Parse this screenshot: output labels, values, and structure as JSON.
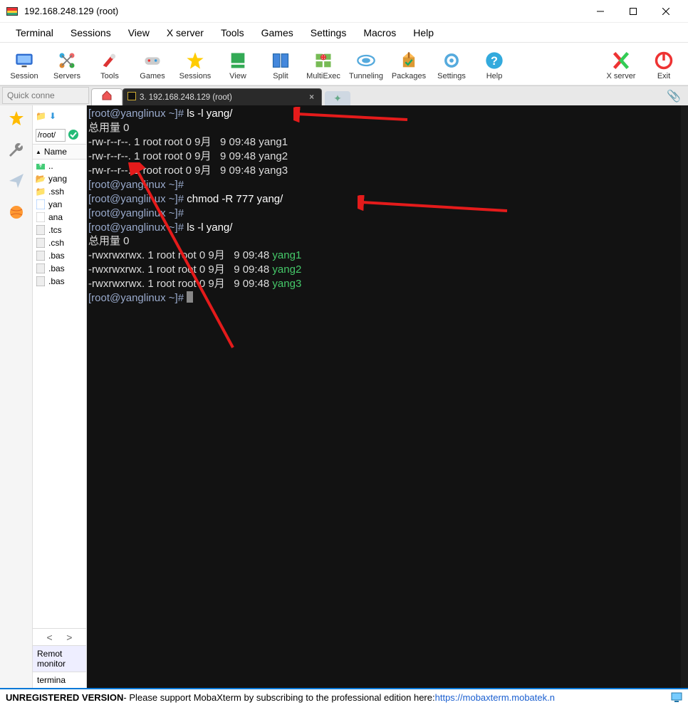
{
  "title": "192.168.248.129 (root)",
  "menus": [
    "Terminal",
    "Sessions",
    "View",
    "X server",
    "Tools",
    "Games",
    "Settings",
    "Macros",
    "Help"
  ],
  "toolbar": [
    {
      "id": "session",
      "label": "Session"
    },
    {
      "id": "servers",
      "label": "Servers"
    },
    {
      "id": "tools",
      "label": "Tools"
    },
    {
      "id": "games",
      "label": "Games"
    },
    {
      "id": "sessions",
      "label": "Sessions"
    },
    {
      "id": "view",
      "label": "View"
    },
    {
      "id": "split",
      "label": "Split"
    },
    {
      "id": "multiexec",
      "label": "MultiExec"
    },
    {
      "id": "tunneling",
      "label": "Tunneling"
    },
    {
      "id": "packages",
      "label": "Packages"
    },
    {
      "id": "settings",
      "label": "Settings"
    },
    {
      "id": "help",
      "label": "Help"
    },
    {
      "id": "xserver",
      "label": "X server"
    },
    {
      "id": "exit",
      "label": "Exit"
    }
  ],
  "quick_connect_placeholder": "Quick conne",
  "tab": {
    "label": "3. 192.168.248.129 (root)"
  },
  "sftp": {
    "path": "/root/",
    "head": "Name",
    "items": [
      {
        "name": "..",
        "type": "up"
      },
      {
        "name": "yang",
        "type": "folder-o"
      },
      {
        "name": ".ssh",
        "type": "folder"
      },
      {
        "name": "yan",
        "type": "file"
      },
      {
        "name": "ana",
        "type": "file-d"
      },
      {
        "name": ".tcs",
        "type": "file-g"
      },
      {
        "name": ".csh",
        "type": "file-g"
      },
      {
        "name": ".bas",
        "type": "file-g"
      },
      {
        "name": ".bas",
        "type": "file-g"
      },
      {
        "name": ".bas",
        "type": "file-g"
      }
    ],
    "foot1": "Remot",
    "foot2": "monitor",
    "foot3": "termina"
  },
  "term": {
    "l1_pre": "[root@yanglinux ~]# ",
    "l1_cmd": "ls -l yang/",
    "l2": "总用量 0",
    "l3": "-rw-r--r--. 1 root root 0 9月   9 09:48 yang1",
    "l4": "-rw-r--r--. 1 root root 0 9月   9 09:48 yang2",
    "l5": "-rw-r--r--. 1 root root 0 9月   9 09:48 yang3",
    "l6": "[root@yanglinux ~]# ",
    "l7_pre": "[root@yanglinux ~]# ",
    "l7_cmd": "chmod -R 777 yang/",
    "l8": "[root@yanglinux ~]# ",
    "l9_pre": "[root@yanglinux ~]# ",
    "l9_cmd": "ls -l yang/",
    "l10": "总用量 0",
    "l11_a": "-rwxrwxrwx. 1 root root 0 9月   9 09:48 ",
    "l11_b": "yang1",
    "l12_a": "-rwxrwxrwx. 1 root root 0 9月   9 09:48 ",
    "l12_b": "yang2",
    "l13_a": "-rwxrwxrwx. 1 root root 0 9月   9 09:48 ",
    "l13_b": "yang3",
    "l14": "[root@yanglinux ~]# "
  },
  "footer": {
    "version": "UNREGISTERED VERSION",
    "msg": "  -  Please support MobaXterm by subscribing to the professional edition here:  ",
    "url": "https://mobaxterm.mobatek.n"
  }
}
